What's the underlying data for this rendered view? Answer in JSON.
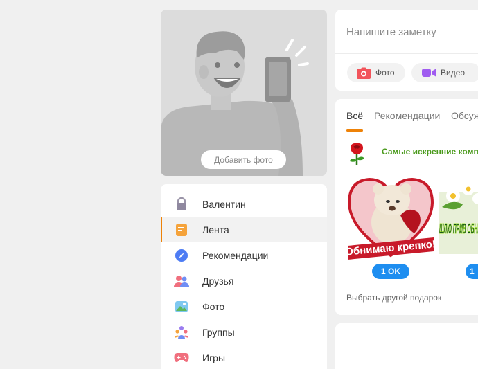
{
  "profile": {
    "add_photo_label": "Добавить фото"
  },
  "nav": {
    "items": [
      {
        "label": "Валентин",
        "icon": "lock-icon"
      },
      {
        "label": "Лента",
        "icon": "feed-icon"
      },
      {
        "label": "Рекомендации",
        "icon": "compass-icon"
      },
      {
        "label": "Друзья",
        "icon": "friends-icon"
      },
      {
        "label": "Фото",
        "icon": "photo-icon"
      },
      {
        "label": "Группы",
        "icon": "groups-icon"
      },
      {
        "label": "Игры",
        "icon": "gamepad-icon"
      }
    ],
    "active_index": 1,
    "accent_color": "#ee8208"
  },
  "note": {
    "placeholder": "Напишите заметку",
    "photo_label": "Фото",
    "video_label": "Видео"
  },
  "feed": {
    "tabs": [
      "Всё",
      "Рекомендации",
      "Обсуж"
    ],
    "gift_title": "Самые искренние комп",
    "gift1_caption": "Обнимаю крепко!",
    "gift2_caption": "ШЛЮ ПРИВ ОБНИ",
    "gift1_price": "1 OK",
    "gift2_price": "1",
    "other_gift_link": "Выбрать другой подарок"
  },
  "colors": {
    "accent": "#ee8208",
    "ok_blue": "#1e8ef0",
    "gift_green": "#4a9a1c"
  }
}
